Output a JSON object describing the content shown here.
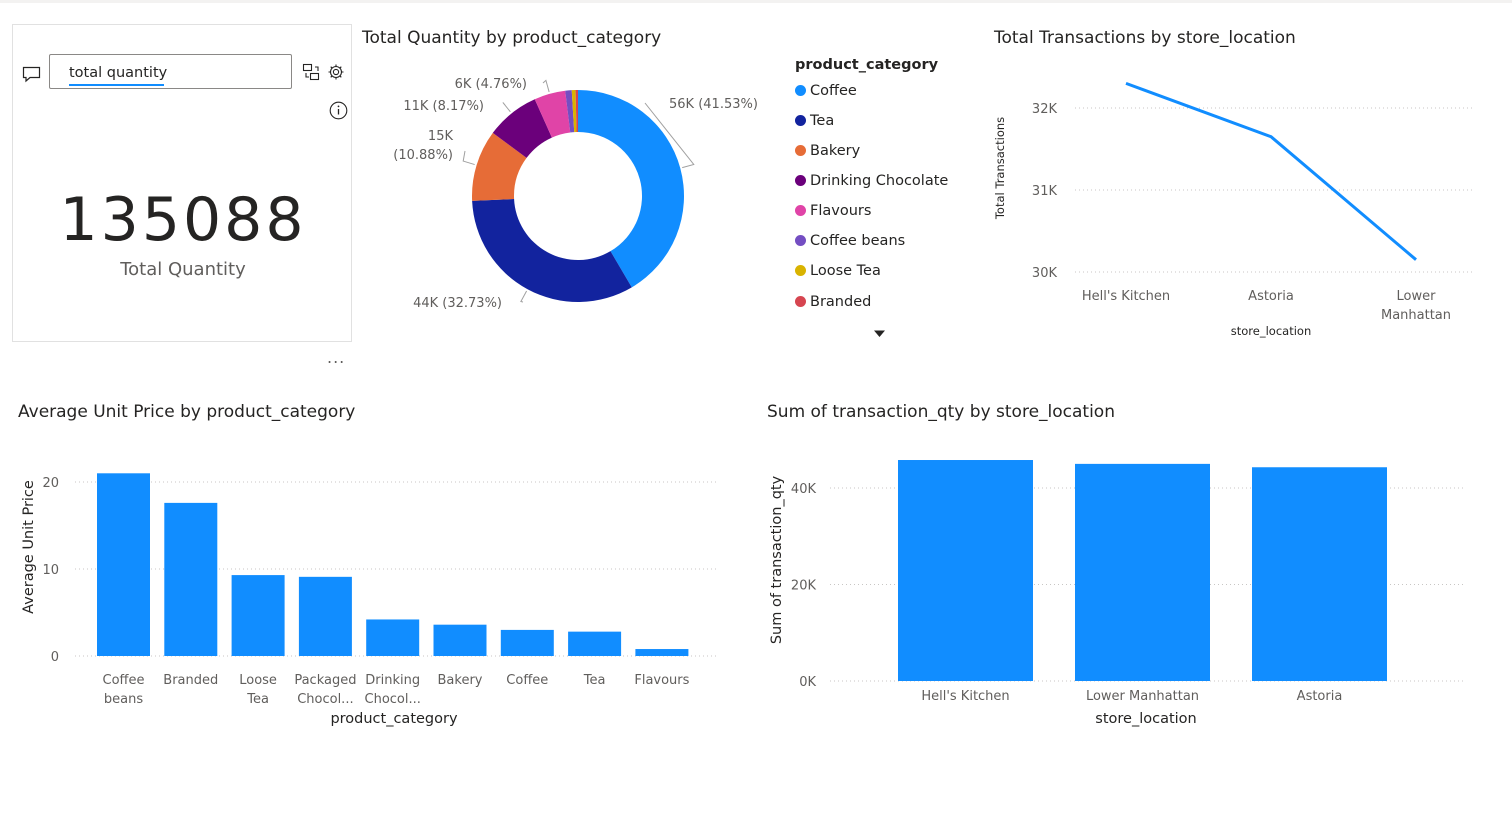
{
  "qa": {
    "input_value": "total quantity",
    "more_label": "..."
  },
  "kpi": {
    "value": "135088",
    "label": "Total Quantity"
  },
  "charts": {
    "donut_title": "Total Quantity by product_category",
    "line_title": "Total Transactions by store_location",
    "bar_price_title": "Average Unit Price by product_category",
    "bar_qty_title": "Sum of transaction_qty by store_location"
  },
  "legend": {
    "title": "product_category",
    "items": [
      {
        "label": "Coffee",
        "color": "#118dff"
      },
      {
        "label": "Tea",
        "color": "#12239e"
      },
      {
        "label": "Bakery",
        "color": "#e66c37"
      },
      {
        "label": "Drinking Chocolate",
        "color": "#6b007b"
      },
      {
        "label": "Flavours",
        "color": "#e044a7"
      },
      {
        "label": "Coffee beans",
        "color": "#744ec2"
      },
      {
        "label": "Loose Tea",
        "color": "#d9b300"
      },
      {
        "label": "Branded",
        "color": "#d64550"
      }
    ]
  },
  "chart_data": [
    {
      "type": "pie",
      "title": "Total Quantity by product_category",
      "categories": [
        "Coffee",
        "Tea",
        "Bakery",
        "Drinking Chocolate",
        "Flavours",
        "Coffee beans",
        "Loose Tea",
        "Branded"
      ],
      "values": [
        56104,
        44215,
        14699,
        11035,
        6431,
        1332,
        778,
        494
      ],
      "colors": [
        "#118dff",
        "#12239e",
        "#e66c37",
        "#6b007b",
        "#e044a7",
        "#744ec2",
        "#d9b300",
        "#d64550"
      ],
      "labels": [
        {
          "cat": "Coffee",
          "lines": [
            "56K (41.53%)"
          ]
        },
        {
          "cat": "Tea",
          "lines": [
            "44K (32.73%)"
          ]
        },
        {
          "cat": "Bakery",
          "lines": [
            "15K",
            "(10.88%)"
          ]
        },
        {
          "cat": "Drinking Chocolate",
          "lines": [
            "11K (8.17%)"
          ]
        },
        {
          "cat": "Flavours",
          "lines": [
            "6K (4.76%)"
          ]
        }
      ]
    },
    {
      "type": "line",
      "title": "Total Transactions by store_location",
      "categories": [
        "Hell's Kitchen",
        "Astoria",
        "Lower Manhattan"
      ],
      "values": [
        32300,
        31650,
        30150
      ],
      "xlabel": "store_location",
      "ylabel": "Total Transactions",
      "yticks": [
        "30K",
        "31K",
        "32K"
      ],
      "ylim": [
        30000,
        32000
      ],
      "grid": true
    },
    {
      "type": "bar",
      "title": "Average Unit Price by product_category",
      "categories": [
        "Coffee beans",
        "Branded",
        "Loose Tea",
        "Packaged Chocol...",
        "Drinking Chocol...",
        "Bakery",
        "Coffee",
        "Tea",
        "Flavours"
      ],
      "values": [
        21.0,
        17.6,
        9.3,
        9.1,
        4.2,
        3.6,
        3.0,
        2.8,
        0.8
      ],
      "xlabel": "product_category",
      "ylabel": "Average Unit Price",
      "yticks": [
        "0",
        "10",
        "20"
      ],
      "ylim": [
        0,
        20
      ],
      "grid": true
    },
    {
      "type": "bar",
      "title": "Sum of transaction_qty by store_location",
      "categories": [
        "Hell's Kitchen",
        "Lower Manhattan",
        "Astoria"
      ],
      "values": [
        45800,
        45000,
        44300
      ],
      "xlabel": "store_location",
      "ylabel": "Sum of transaction_qty",
      "yticks": [
        "0K",
        "20K",
        "40K"
      ],
      "ylim": [
        0,
        40000
      ],
      "grid": true
    }
  ]
}
